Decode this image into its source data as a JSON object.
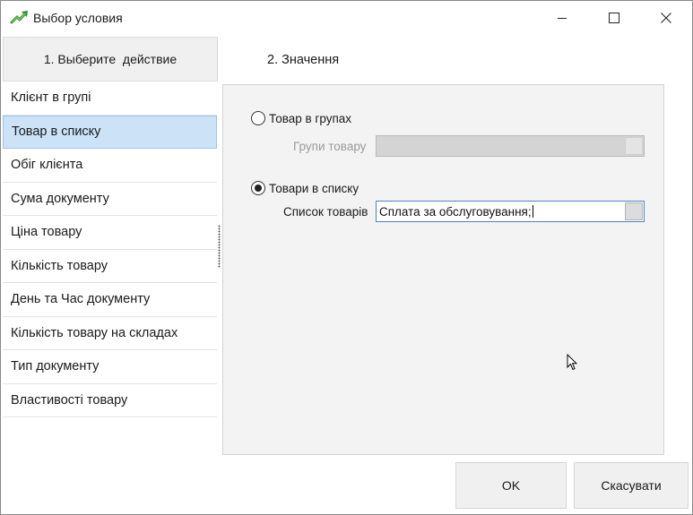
{
  "window": {
    "title": "Выбор условия",
    "icon": "green-arrow-icon",
    "controls": [
      "minimize-icon",
      "maximize-icon",
      "close-icon"
    ]
  },
  "left_panel": {
    "header": "1. Выберите  действие",
    "items": [
      {
        "label": "Клієнт в групі",
        "selected": false
      },
      {
        "label": "Товар в списку",
        "selected": true
      },
      {
        "label": "Обіг клієнта",
        "selected": false
      },
      {
        "label": "Сума документу",
        "selected": false
      },
      {
        "label": "Ціна товару",
        "selected": false
      },
      {
        "label": "Кількість товару",
        "selected": false
      },
      {
        "label": "День та Час документу",
        "selected": false
      },
      {
        "label": "Кількість товару на складах",
        "selected": false
      },
      {
        "label": "Тип документу",
        "selected": false
      },
      {
        "label": "Властивості товару",
        "selected": false
      }
    ]
  },
  "right_panel": {
    "header": "2. Значення",
    "option_groups": {
      "label": "Товар в групах",
      "checked": false,
      "field_label": "Групи товару",
      "field_value": ""
    },
    "option_list": {
      "label": "Товари в списку",
      "checked": true,
      "field_label": "Список товарів",
      "field_value": "Сплата за обслуговування;"
    }
  },
  "buttons": {
    "ok": "OK",
    "cancel": "Скасувати"
  },
  "colors": {
    "selection": "#cce3f7",
    "panel_bg": "#f3f3f3",
    "active_border": "#4a86c5"
  }
}
